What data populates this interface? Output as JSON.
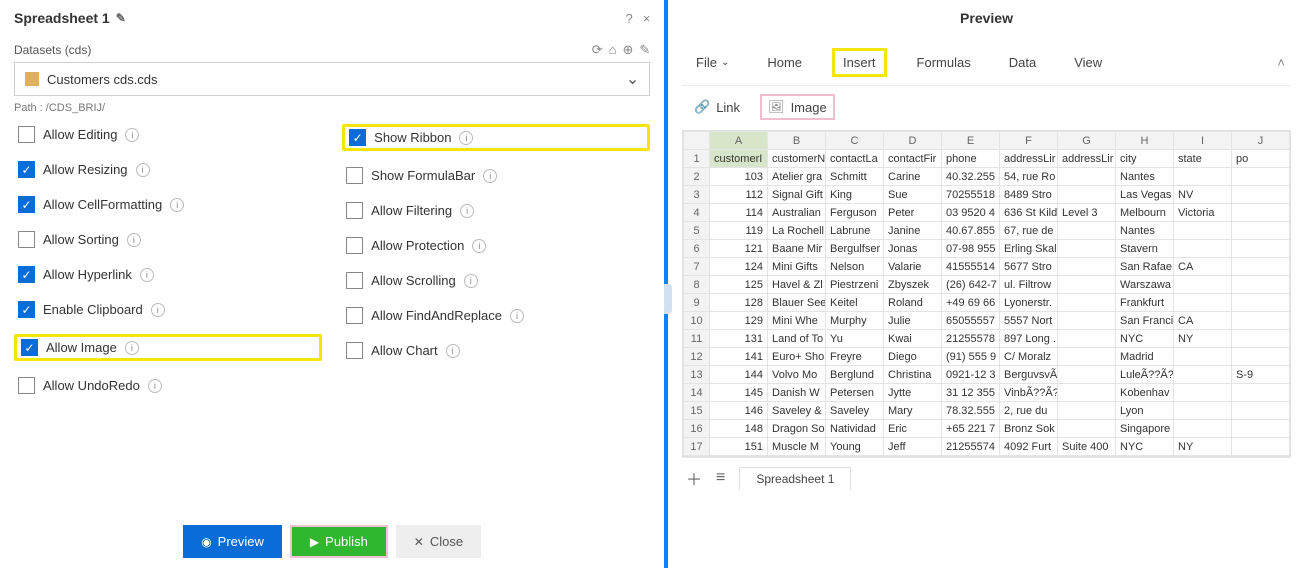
{
  "header": {
    "title": "Spreadsheet 1",
    "help": "?",
    "close": "×"
  },
  "datasets": {
    "label": "Datasets (cds)",
    "selected": "Customers cds.cds",
    "path_label": "Path : /CDS_BRIJ/"
  },
  "options_left": [
    {
      "label": "Allow Editing",
      "checked": false
    },
    {
      "label": "Allow Resizing",
      "checked": true
    },
    {
      "label": "Allow CellFormatting",
      "checked": true
    },
    {
      "label": "Allow Sorting",
      "checked": false
    },
    {
      "label": "Allow Hyperlink",
      "checked": true
    },
    {
      "label": "Enable Clipboard",
      "checked": true
    },
    {
      "label": "Allow Image",
      "checked": true,
      "highlight": true
    },
    {
      "label": "Allow UndoRedo",
      "checked": false
    }
  ],
  "options_right": [
    {
      "label": "Show Ribbon",
      "checked": true,
      "highlight": true
    },
    {
      "label": "Show FormulaBar",
      "checked": false
    },
    {
      "label": "Allow Filtering",
      "checked": false
    },
    {
      "label": "Allow Protection",
      "checked": false
    },
    {
      "label": "Allow Scrolling",
      "checked": false
    },
    {
      "label": "Allow FindAndReplace",
      "checked": false
    },
    {
      "label": "Allow Chart",
      "checked": false
    }
  ],
  "buttons": {
    "preview": "Preview",
    "publish": "Publish",
    "close": "Close"
  },
  "preview": {
    "title": "Preview",
    "tabs": {
      "file": "File",
      "home": "Home",
      "insert": "Insert",
      "formulas": "Formulas",
      "data": "Data",
      "view": "View"
    },
    "tools": {
      "link": "Link",
      "image": "Image"
    },
    "sheet_tab": "Spreadsheet 1"
  },
  "sheet": {
    "columns": [
      "A",
      "B",
      "C",
      "D",
      "E",
      "F",
      "G",
      "H",
      "I",
      "J"
    ],
    "headers_row": [
      "customerI",
      "customerN",
      "contactLa",
      "contactFir",
      "phone",
      "addressLir",
      "addressLir",
      "city",
      "state",
      "po"
    ],
    "rows": [
      [
        "103",
        "Atelier gra",
        "Schmitt",
        "Carine",
        "40.32.255",
        "54, rue Ro",
        "",
        "Nantes",
        "",
        ""
      ],
      [
        "112",
        "Signal Gift",
        "King",
        "Sue",
        "70255518",
        "8489 Stro",
        "",
        "Las Vegas",
        "NV",
        ""
      ],
      [
        "114",
        "Australian",
        "Ferguson",
        "Peter",
        "03 9520 4",
        "636 St Kild",
        "Level 3",
        "Melbourn",
        "Victoria",
        ""
      ],
      [
        "119",
        "La Rochell",
        "Labrune",
        "Janine",
        "40.67.855",
        "67, rue de",
        "",
        "Nantes",
        "",
        ""
      ],
      [
        "121",
        "Baane Mir",
        "Bergulfser",
        "Jonas",
        "07-98 955",
        "Erling Skal",
        "",
        "Stavern",
        "",
        ""
      ],
      [
        "124",
        "Mini Gifts",
        "Nelson",
        "Valarie",
        "41555514",
        "5677 Stro",
        "",
        "San Rafae",
        "CA",
        ""
      ],
      [
        "125",
        "Havel & Zl",
        "Piestrzeni",
        "Zbyszek",
        "(26) 642-7",
        "ul. Filtrow",
        "",
        "Warszawa",
        "",
        ""
      ],
      [
        "128",
        "Blauer See",
        "Keitel",
        "Roland",
        "+49 69 66",
        "Lyonerstr.",
        "",
        "Frankfurt",
        "",
        ""
      ],
      [
        "129",
        "Mini Whe",
        "Murphy",
        "Julie",
        "65055557",
        "5557 Nort",
        "",
        "San Franci",
        "CA",
        ""
      ],
      [
        "131",
        "Land of To",
        "Yu",
        "Kwai",
        "21255578",
        "897 Long .",
        "",
        "NYC",
        "NY",
        ""
      ],
      [
        "141",
        "Euro+ Sho",
        "Freyre",
        "Diego",
        "(91) 555 9",
        "C/ Moralz",
        "",
        "Madrid",
        "",
        ""
      ],
      [
        "144",
        "Volvo Mo",
        "Berglund",
        "Christina",
        "0921-12 3",
        "BerguvsvÃ",
        "",
        "LuleÃ??Ã?",
        "",
        "S-9"
      ],
      [
        "145",
        "Danish W",
        "Petersen",
        "Jytte",
        "31 12 355",
        "VinbÃ??Ã?",
        "",
        "Kobenhav",
        "",
        ""
      ],
      [
        "146",
        "Saveley &",
        "Saveley",
        "Mary",
        "78.32.555",
        "2, rue du",
        "",
        "Lyon",
        "",
        ""
      ],
      [
        "148",
        "Dragon So",
        "Natividad",
        "Eric",
        "+65 221 7",
        "Bronz Sok",
        "",
        "Singapore",
        "",
        ""
      ],
      [
        "151",
        "Muscle M",
        "Young",
        "Jeff",
        "21255574",
        "4092 Furt",
        "Suite 400",
        "NYC",
        "NY",
        ""
      ]
    ]
  }
}
